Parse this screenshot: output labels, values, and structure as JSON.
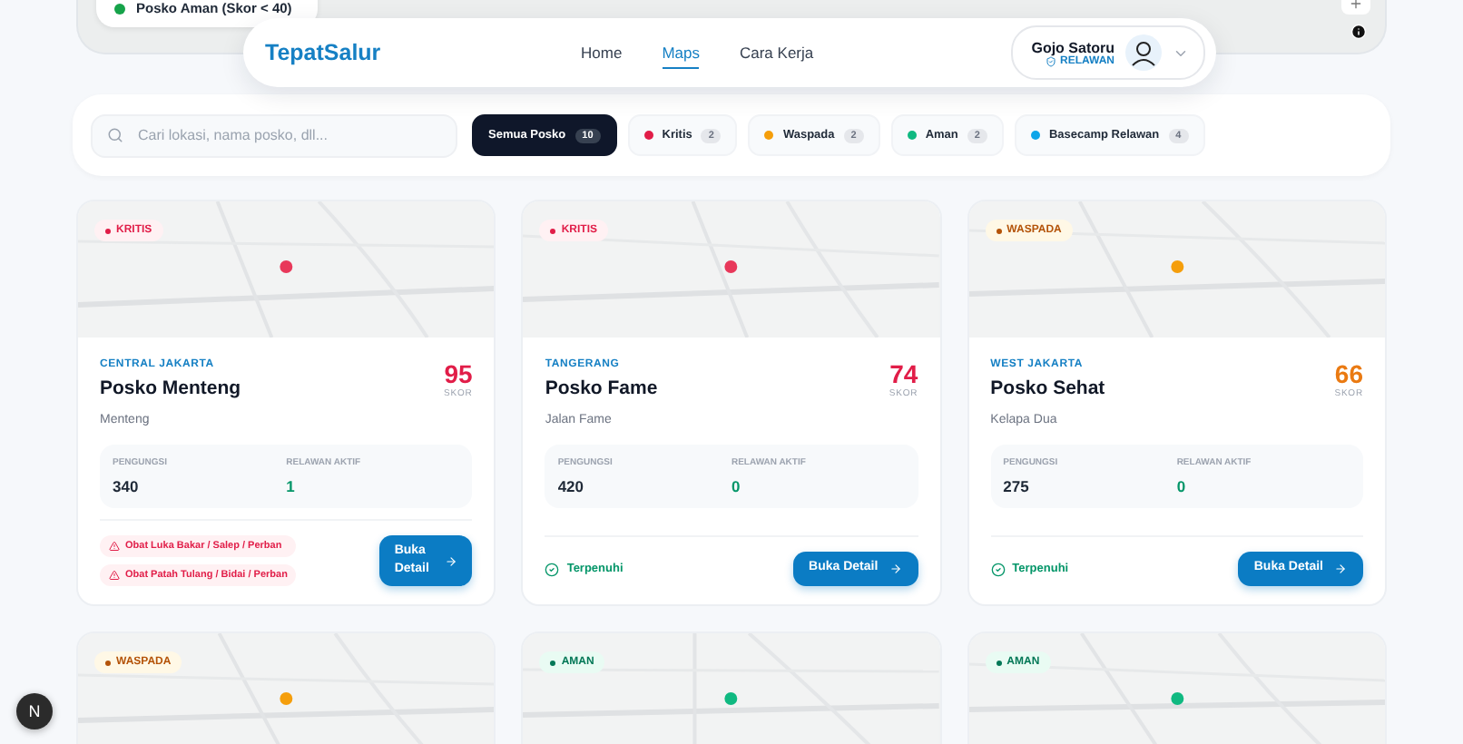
{
  "map_legend": {
    "label": "Posko Aman (Skor < 40)",
    "color": "#16a34a"
  },
  "navbar": {
    "brand": "TepatSalur",
    "links": [
      {
        "label": "Home",
        "selected": false
      },
      {
        "label": "Maps",
        "selected": true
      },
      {
        "label": "Cara Kerja",
        "selected": false
      }
    ],
    "user": {
      "name": "Gojo Satoru",
      "role": "RELAWAN"
    }
  },
  "search": {
    "placeholder": "Cari lokasi, nama posko, dll..."
  },
  "filters": [
    {
      "label": "Semua Posko",
      "count": "10",
      "selected": true
    },
    {
      "label": "Kritis",
      "count": "2",
      "selected": false,
      "color": "#e11d48"
    },
    {
      "label": "Waspada",
      "count": "2",
      "selected": false,
      "color": "#f59e0b"
    },
    {
      "label": "Aman",
      "count": "2",
      "selected": false,
      "color": "#10b981"
    },
    {
      "label": "Basecamp Relawan",
      "count": "4",
      "selected": false,
      "color": "#0ea5e9"
    }
  ],
  "cards": [
    {
      "kind": "kritis",
      "badge": "KRITIS",
      "region": "CENTRAL JAKARTA",
      "name": "Posko Menteng",
      "address": "Menteng",
      "score": "95",
      "score_label": "SKOR",
      "stats": [
        {
          "label": "PENGUNGSI",
          "value": "340",
          "kind": "people"
        },
        {
          "label": "RELAWAN AKTIF",
          "value": "1",
          "kind": "volunteer"
        }
      ],
      "footer": {
        "kind": "needs",
        "items": [
          "Obat Luka Bakar / Salep / Perban",
          "Obat Patah Tulang / Bidai / Perban"
        ]
      },
      "button": "Buka Detail"
    },
    {
      "kind": "kritis",
      "badge": "KRITIS",
      "region": "TANGERANG",
      "name": "Posko Fame",
      "address": "Jalan Fame",
      "score": "74",
      "score_label": "SKOR",
      "stats": [
        {
          "label": "PENGUNGSI",
          "value": "420",
          "kind": "people"
        },
        {
          "label": "RELAWAN AKTIF",
          "value": "0",
          "kind": "volunteer"
        }
      ],
      "footer": {
        "kind": "fulfilled",
        "text": "Terpenuhi"
      },
      "button": "Buka Detail"
    },
    {
      "kind": "waspada",
      "badge": "WASPADA",
      "region": "WEST JAKARTA",
      "name": "Posko Sehat",
      "address": "Kelapa Dua",
      "score": "66",
      "score_label": "SKOR",
      "stats": [
        {
          "label": "PENGUNGSI",
          "value": "275",
          "kind": "people"
        },
        {
          "label": "RELAWAN AKTIF",
          "value": "0",
          "kind": "volunteer"
        }
      ],
      "footer": {
        "kind": "fulfilled",
        "text": "Terpenuhi"
      },
      "button": "Buka Detail"
    },
    {
      "kind": "waspada",
      "badge": "WASPADA"
    },
    {
      "kind": "aman",
      "badge": "AMAN"
    },
    {
      "kind": "aman",
      "badge": "AMAN"
    }
  ],
  "dev_badge": "N"
}
